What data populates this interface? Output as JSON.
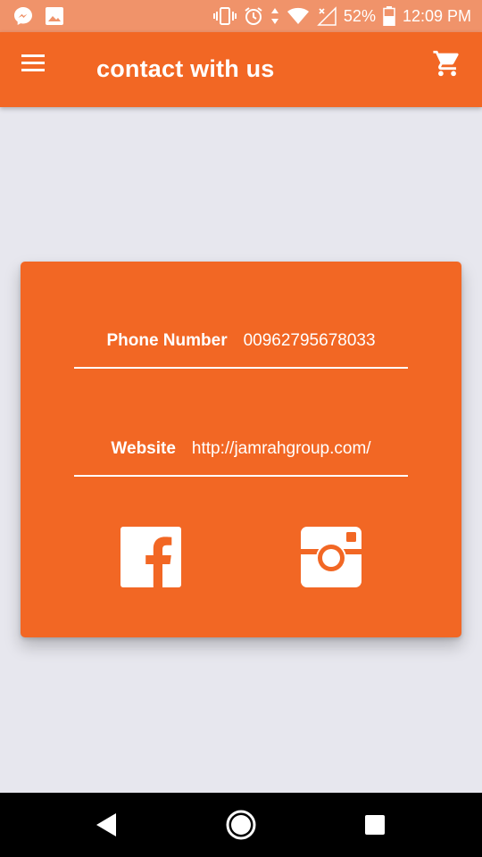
{
  "status_bar": {
    "battery": "52%",
    "time": "12:09 PM"
  },
  "app_bar": {
    "title": "contact with us"
  },
  "contact": {
    "phone_label": "Phone Number",
    "phone_value": "00962795678033",
    "website_label": "Website",
    "website_value": "http://jamrahgroup.com/"
  },
  "colors": {
    "primary": "#f26724",
    "status_bar": "#f0936a",
    "background": "#e7e7ee",
    "text_on_primary": "#ffffff"
  },
  "icons": {
    "menu": "hamburger-menu-icon",
    "cart": "shopping-cart-icon",
    "facebook": "facebook-icon",
    "instagram": "instagram-icon"
  }
}
